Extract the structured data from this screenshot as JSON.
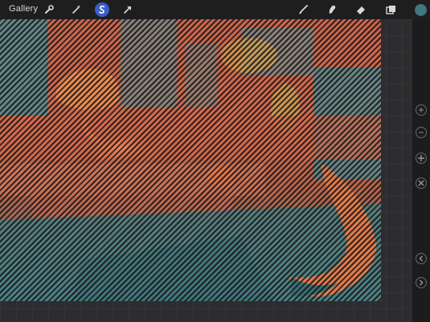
{
  "topbar": {
    "gallery_label": "Gallery",
    "left_tools": [
      "wrench-icon",
      "magic-wand-icon",
      "selection-icon",
      "transform-arrow-icon"
    ],
    "right_tools": [
      "brush-icon",
      "smudge-icon",
      "eraser-icon",
      "layers-icon"
    ],
    "current_color": "#3d7a7e",
    "active_tool_color": "#3a5ccc"
  },
  "sidebar": {
    "buttons": [
      "size-slider-up-icon",
      "size-slider-down-icon",
      "modify-plus-icon",
      "close-icon",
      "undo-chevron-icon",
      "redo-chevron-icon"
    ]
  }
}
